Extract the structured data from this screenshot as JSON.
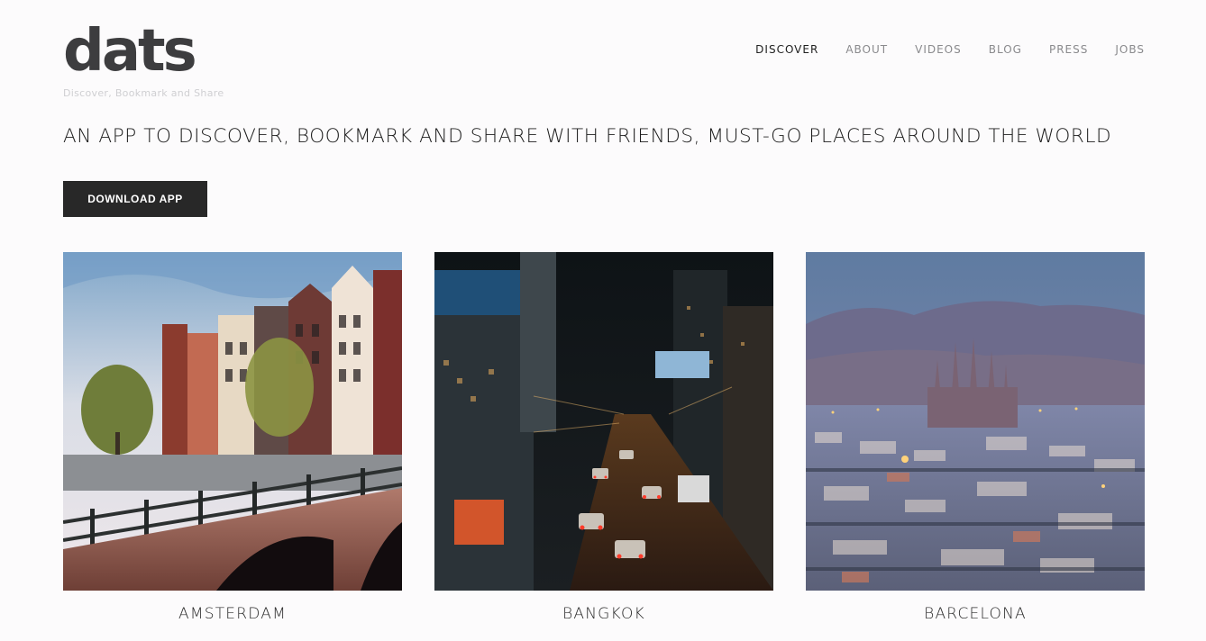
{
  "brand": {
    "logo_text": "dats",
    "tagline": "Discover, Bookmark and Share",
    "logo_color": "#3d3d3f"
  },
  "nav": {
    "items": [
      {
        "label": "DISCOVER",
        "active": true
      },
      {
        "label": "ABOUT",
        "active": false
      },
      {
        "label": "VIDEOS",
        "active": false
      },
      {
        "label": "BLOG",
        "active": false
      },
      {
        "label": "PRESS",
        "active": false
      },
      {
        "label": "JOBS",
        "active": false
      }
    ]
  },
  "hero": {
    "headline": "AN APP TO DISCOVER, BOOKMARK AND SHARE WITH FRIENDS, MUST-GO PLACES AROUND THE WORLD",
    "cta_label": "DOWNLOAD APP"
  },
  "cities": [
    {
      "name": "AMSTERDAM"
    },
    {
      "name": "BANGKOK"
    },
    {
      "name": "BARCELONA"
    }
  ],
  "colors": {
    "background": "#fcfbfc",
    "button_bg": "#282828",
    "button_text": "#ffffff",
    "nav_inactive": "#8a8a8d",
    "nav_active": "#1f1f1f"
  }
}
